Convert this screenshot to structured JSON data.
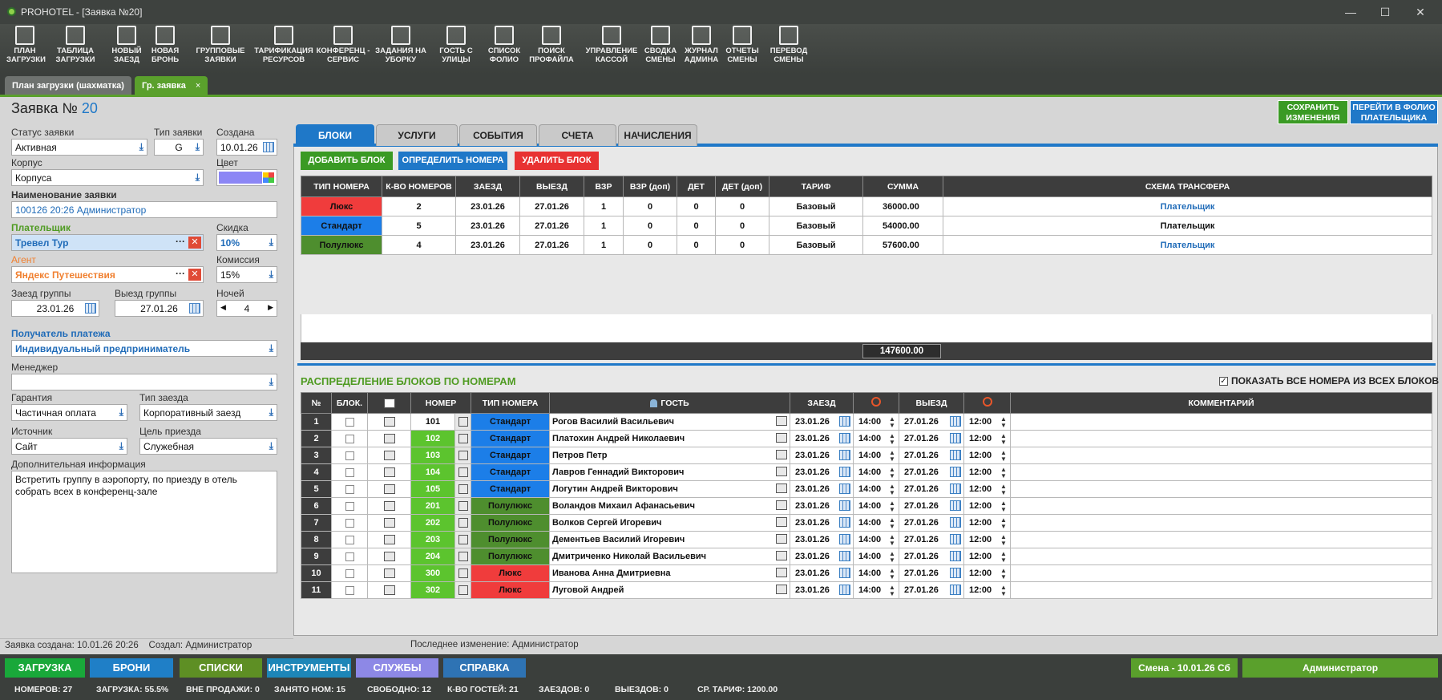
{
  "window": {
    "title": "PROHOTEL - [Заявка №20]"
  },
  "toolbar": [
    {
      "label1": "ПЛАН",
      "label2": "ЗАГРУЗКИ",
      "icon": "bars-icon"
    },
    {
      "label1": "ТАБЛИЦА",
      "label2": "ЗАГРУЗКИ",
      "icon": "table-icon"
    },
    {
      "label1": "НОВЫЙ",
      "label2": "ЗАЕЗД",
      "icon": "checkin-icon"
    },
    {
      "label1": "НОВАЯ",
      "label2": "БРОНЬ",
      "icon": "booking-icon"
    },
    {
      "label1": "ГРУППОВЫЕ",
      "label2": "ЗАЯВКИ",
      "icon": "group-icon"
    },
    {
      "label1": "ТАРИФИКАЦИЯ",
      "label2": "РЕСУРСОВ",
      "icon": "gauge-icon"
    },
    {
      "label1": "КОНФЕРЕНЦ -",
      "label2": "СЕРВИС",
      "icon": "pie-icon"
    },
    {
      "label1": "ЗАДАНИЯ НА",
      "label2": "УБОРКУ",
      "icon": "cleaning-icon"
    },
    {
      "label1": "ГОСТЬ С",
      "label2": "УЛИЦЫ",
      "icon": "walkin-icon"
    },
    {
      "label1": "СПИСОК",
      "label2": "ФОЛИО",
      "icon": "folio-icon"
    },
    {
      "label1": "ПОИСК",
      "label2": "ПРОФАЙЛА",
      "icon": "search-icon"
    },
    {
      "label1": "УПРАВЛЕНИЕ",
      "label2": "КАССОЙ",
      "icon": "cash-icon"
    },
    {
      "label1": "СВОДКА",
      "label2": "СМЕНЫ",
      "icon": "summary-icon"
    },
    {
      "label1": "ЖУРНАЛ",
      "label2": "АДМИНА",
      "icon": "journal-icon"
    },
    {
      "label1": "ОТЧЕТЫ",
      "label2": "СМЕНЫ",
      "icon": "reports-icon"
    },
    {
      "label1": "ПЕРЕВОД",
      "label2": "СМЕНЫ",
      "icon": "refresh-icon"
    }
  ],
  "doc_tabs": {
    "tab1": "План загрузки (шахматка)",
    "tab2": "Гр. заявка",
    "close": "×"
  },
  "header": {
    "title": "Заявка №",
    "number": "20",
    "save_label": "СОХРАНИТЬ ИЗМЕНЕНИЯ",
    "goto_label": "ПЕРЕЙТИ В ФОЛИО ПЛАТЕЛЬЩИКА"
  },
  "form": {
    "status_label": "Статус заявки",
    "status_value": "Активная",
    "type_label": "Тип заявки",
    "type_value": "G",
    "created_label": "Создана",
    "created_value": "10.01.26",
    "building_label": "Корпус",
    "building_value": "Корпуса",
    "color_label": "Цвет",
    "color_value": "#8c86f5",
    "name_label": "Наименование заявки",
    "name_value": "100126 20:26  Администратор",
    "payer_label": "Плательщик",
    "payer_value": "Тревел Тур",
    "discount_label": "Скидка",
    "discount_value": "10%",
    "agent_label": "Агент",
    "agent_value": "Яндекс Путешествия",
    "commission_label": "Комиссия",
    "commission_value": "15%",
    "arrival_label": "Заезд группы",
    "arrival_value": "23.01.26",
    "departure_label": "Выезд группы",
    "departure_value": "27.01.26",
    "nights_label": "Ночей",
    "nights_value": "4",
    "recipient_label": "Получатель платежа",
    "recipient_value": "Индивидуальный предприниматель",
    "manager_label": "Менеджер",
    "manager_value": "",
    "guarantee_label": "Гарантия",
    "guarantee_value": "Частичная оплата",
    "checkin_type_label": "Тип заезда",
    "checkin_type_value": "Корпоративный заезд",
    "source_label": "Источник",
    "source_value": "Сайт",
    "purpose_label": "Цель приезда",
    "purpose_value": "Служебная",
    "info_label": "Дополнительная информация",
    "info_value": "Встретить группу в аэропорту, по приезду в отель собрать всех в конференц-зале"
  },
  "footer_info": {
    "created_label": "Заявка создана:",
    "created_value": "10.01.26 20:26",
    "creator_label": "Создал:",
    "creator_value": "Администратор",
    "changed_label": "Последнее изменение:",
    "changed_value": "Администратор"
  },
  "content_tabs": [
    "БЛОКИ",
    "УСЛУГИ",
    "СОБЫТИЯ",
    "СЧЕТА",
    "НАЧИСЛЕНИЯ"
  ],
  "block_actions": {
    "add": "ДОБАВИТЬ БЛОК",
    "define": "ОПРЕДЕЛИТЬ НОМЕРА",
    "delete": "УДАЛИТЬ БЛОК"
  },
  "blocks_table": {
    "headers": [
      "ТИП НОМЕРА",
      "К-ВО НОМЕРОВ",
      "ЗАЕЗД",
      "ВЫЕЗД",
      "ВЗР",
      "ВЗР (доп)",
      "ДЕТ",
      "ДЕТ (доп)",
      "ТАРИФ",
      "СУММА",
      "СХЕМА ТРАНСФЕРА"
    ],
    "rows": [
      {
        "type": "Люкс",
        "color": "#f03c3c",
        "count": "2",
        "arr": "23.01.26",
        "dep": "27.01.26",
        "adl": "1",
        "adl_ex": "0",
        "ch": "0",
        "ch_ex": "0",
        "tariff": "Базовый",
        "sum": "36000.00",
        "transfer": "Плательщик",
        "link": true
      },
      {
        "type": "Стандарт",
        "color": "#1c7ee8",
        "count": "5",
        "arr": "23.01.26",
        "dep": "27.01.26",
        "adl": "1",
        "adl_ex": "0",
        "ch": "0",
        "ch_ex": "0",
        "tariff": "Базовый",
        "sum": "54000.00",
        "transfer": "Плательщик",
        "link": false
      },
      {
        "type": "Полулюкс",
        "color": "#4e8e2e",
        "count": "4",
        "arr": "23.01.26",
        "dep": "27.01.26",
        "adl": "1",
        "adl_ex": "0",
        "ch": "0",
        "ch_ex": "0",
        "tariff": "Базовый",
        "sum": "57600.00",
        "transfer": "Плательщик",
        "link": true
      }
    ],
    "total": "147600.00"
  },
  "distribution": {
    "title": "РАСПРЕДЕЛЕНИЕ БЛОКОВ ПО НОМЕРАМ",
    "show_all_label": "ПОКАЗАТЬ ВСЕ НОМЕРА ИЗ ВСЕХ БЛОКОВ",
    "headers": [
      "№",
      "БЛОК.",
      "",
      "НОМЕР",
      "ТИП НОМЕРА",
      "ГОСТЬ",
      "ЗАЕЗД",
      "",
      "ВЫЕЗД",
      "",
      "КОММЕНТАРИЙ"
    ],
    "rows": [
      {
        "n": "1",
        "room": "101",
        "green": false,
        "type": "Стандарт",
        "color": "#1c7ee8",
        "guest": "Рогов Василий Васильевич",
        "arr": "23.01.26",
        "tin": "14:00",
        "dep": "27.01.26",
        "tout": "12:00"
      },
      {
        "n": "2",
        "room": "102",
        "green": true,
        "type": "Стандарт",
        "color": "#1c7ee8",
        "guest": "Платохин Андрей Николаевич",
        "arr": "23.01.26",
        "tin": "14:00",
        "dep": "27.01.26",
        "tout": "12:00"
      },
      {
        "n": "3",
        "room": "103",
        "green": true,
        "type": "Стандарт",
        "color": "#1c7ee8",
        "guest": "Петров Петр",
        "arr": "23.01.26",
        "tin": "14:00",
        "dep": "27.01.26",
        "tout": "12:00"
      },
      {
        "n": "4",
        "room": "104",
        "green": true,
        "type": "Стандарт",
        "color": "#1c7ee8",
        "guest": "Лавров Геннадий Викторович",
        "arr": "23.01.26",
        "tin": "14:00",
        "dep": "27.01.26",
        "tout": "12:00"
      },
      {
        "n": "5",
        "room": "105",
        "green": true,
        "type": "Стандарт",
        "color": "#1c7ee8",
        "guest": "Логутин Андрей Викторович",
        "arr": "23.01.26",
        "tin": "14:00",
        "dep": "27.01.26",
        "tout": "12:00"
      },
      {
        "n": "6",
        "room": "201",
        "green": true,
        "type": "Полулюкс",
        "color": "#4e8e2e",
        "guest": "Воландов Михаил Афанасьевич",
        "arr": "23.01.26",
        "tin": "14:00",
        "dep": "27.01.26",
        "tout": "12:00"
      },
      {
        "n": "7",
        "room": "202",
        "green": true,
        "type": "Полулюкс",
        "color": "#4e8e2e",
        "guest": "Волков Сергей Игоревич",
        "arr": "23.01.26",
        "tin": "14:00",
        "dep": "27.01.26",
        "tout": "12:00"
      },
      {
        "n": "8",
        "room": "203",
        "green": true,
        "type": "Полулюкс",
        "color": "#4e8e2e",
        "guest": "Дементьев Василий Игоревич",
        "arr": "23.01.26",
        "tin": "14:00",
        "dep": "27.01.26",
        "tout": "12:00"
      },
      {
        "n": "9",
        "room": "204",
        "green": true,
        "type": "Полулюкс",
        "color": "#4e8e2e",
        "guest": "Дмитриченко Николай Васильевич",
        "arr": "23.01.26",
        "tin": "14:00",
        "dep": "27.01.26",
        "tout": "12:00"
      },
      {
        "n": "10",
        "room": "300",
        "green": true,
        "type": "Люкс",
        "color": "#f03c3c",
        "guest": "Иванова Анна Дмитриевна",
        "arr": "23.01.26",
        "tin": "14:00",
        "dep": "27.01.26",
        "tout": "12:00"
      },
      {
        "n": "11",
        "room": "302",
        "green": true,
        "type": "Люкс",
        "color": "#f03c3c",
        "guest": "Луговой Андрей",
        "arr": "23.01.26",
        "tin": "14:00",
        "dep": "27.01.26",
        "tout": "12:00"
      }
    ]
  },
  "bottom_nav": [
    {
      "label": "ЗАГРУЗКА",
      "color": "#19a83a"
    },
    {
      "label": "БРОНИ",
      "color": "#1f7fc7"
    },
    {
      "label": "СПИСКИ",
      "color": "#5e8f24"
    },
    {
      "label": "ИНСТРУМЕНТЫ",
      "color": "#1d86b8"
    },
    {
      "label": "СЛУЖБЫ",
      "color": "#8d88e6"
    },
    {
      "label": "СПРАВКА",
      "color": "#2e73b4"
    }
  ],
  "shift": {
    "label": "Смена - 10.01.26  Сб",
    "user": "Администратор"
  },
  "stats": [
    "НОМЕРОВ: 27",
    "ЗАГРУЗКА: 55.5%",
    "ВНЕ ПРОДАЖИ: 0",
    "ЗАНЯТО НОМ: 15",
    "СВОБОДНО: 12",
    "К-ВО ГОСТЕЙ: 21",
    "ЗАЕЗДОВ: 0",
    "ВЫЕЗДОВ: 0",
    "СР. ТАРИФ: 1200.00"
  ]
}
